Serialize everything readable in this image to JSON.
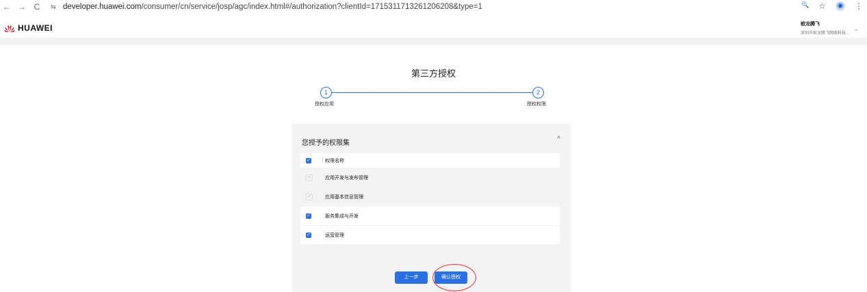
{
  "browser": {
    "back": "←",
    "forward": "→",
    "reload": "C",
    "site_info": "⇆",
    "url_host": "developer.huawei.com",
    "url_path": "/consumer/cn/service/josp/agc/index.html#/authorization?clientId=1715311713261206208&type=1",
    "zoom_icon": "🔍",
    "star_icon": "☆",
    "profile_icon": "◉",
    "menu_icon": "⋮"
  },
  "header": {
    "brand": "HUAWEI",
    "account_name": "蛟龙腾飞",
    "account_org": "深圳市蛟龙腾飞网络科技...",
    "caret": "⌄"
  },
  "page": {
    "title": "第三方授权",
    "steps": [
      {
        "number": "1",
        "label": "授权应用"
      },
      {
        "number": "2",
        "label": "授权权限"
      }
    ]
  },
  "permissions": {
    "title": "您授予的权限集",
    "collapse": "^",
    "header_label": "权限名称",
    "items": [
      {
        "label": "应用开发与发布管理",
        "state": "disabled"
      },
      {
        "label": "应用基本信息管理",
        "state": "disabled"
      },
      {
        "label": "服务集成与开发",
        "state": "on"
      },
      {
        "label": "运营管理",
        "state": "on"
      }
    ],
    "check_mark": "✓"
  },
  "actions": {
    "prev_label": "上一步",
    "confirm_label": "确认授权"
  },
  "colors": {
    "accent": "#2b6fe4",
    "annotation": "#e0312b",
    "panel_bg": "#f1f3f5"
  }
}
